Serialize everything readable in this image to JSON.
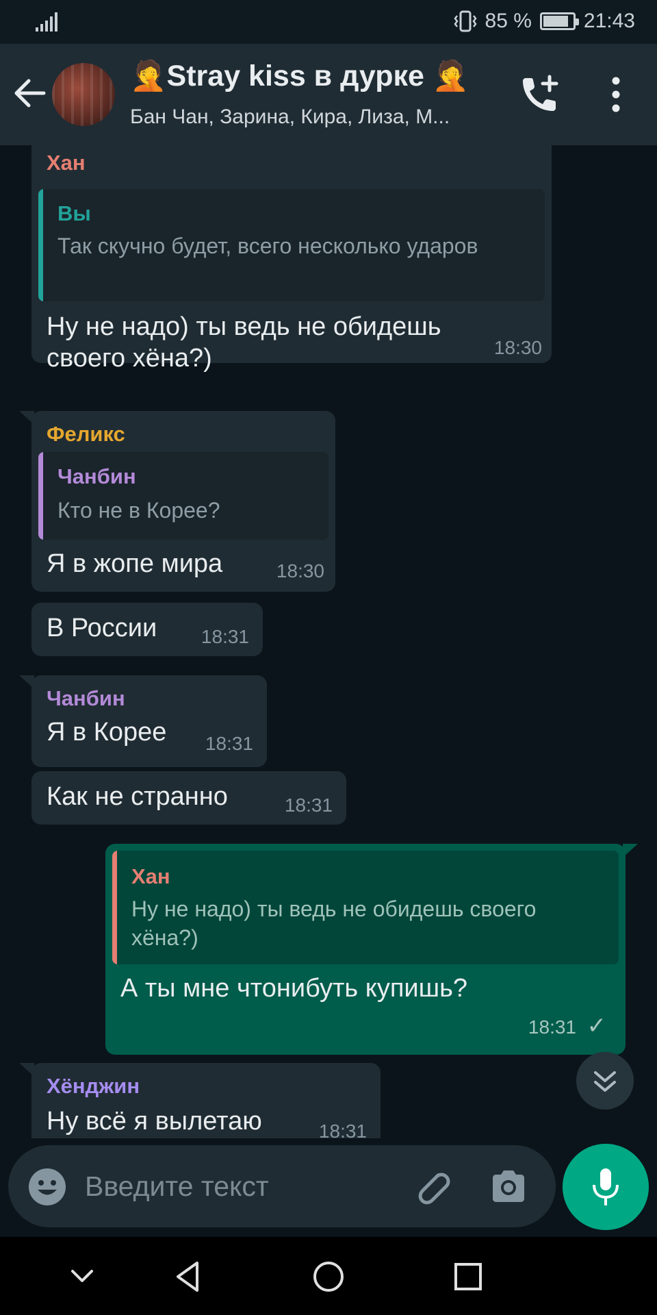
{
  "status_bar": {
    "battery": "85 %",
    "battery_level": 0.85,
    "time": "21:43"
  },
  "header": {
    "title": "🤦Stray kiss в дурке 🤦",
    "subtitle": "Бан Чан, Зарина, Кира, Лиза, М..."
  },
  "colors": {
    "header_bg": "#1f2c34",
    "incoming_bubble": "#202c33",
    "outgoing_bubble": "#005c4b",
    "accent": "#00a884",
    "name_han": "#e57f72",
    "name_felix": "#e5a72f",
    "name_changbin": "#b38ad8",
    "name_you": "#22a39a",
    "name_hyunjin": "#a58df0"
  },
  "messages": [
    {
      "sender": "Хан",
      "quote_name": "Вы",
      "quote_text": "Так скучно будет, всего несколько ударов",
      "text": "Ну не надо) ты ведь не обидешь своего хёна?)",
      "time": "18:30"
    },
    {
      "sender": "Феликс",
      "quote_name": "Чанбин",
      "quote_text": "Кто не в Корее?",
      "text": "Я в жопе мира",
      "time": "18:30"
    },
    {
      "text": "В России",
      "time": "18:31"
    },
    {
      "sender": "Чанбин",
      "text": "Я в Корее",
      "time": "18:31"
    },
    {
      "text": "Как не странно",
      "time": "18:31"
    },
    {
      "quote_name": "Хан",
      "quote_text": "Ну не надо) ты ведь не обидешь своего хёна?)",
      "text": "А ты мне чтонибуть купишь?",
      "time": "18:31",
      "status": "✓"
    },
    {
      "sender": "Хёнджин",
      "text": "Ну всё я вылетаю",
      "time": "18:31"
    }
  ],
  "composer": {
    "placeholder": "Введите текст"
  },
  "icons": {
    "back": "arrow-left-icon",
    "call": "add-call-icon",
    "menu": "more-vertical-icon",
    "emoji": "emoji-icon",
    "attach": "paperclip-icon",
    "camera": "camera-icon",
    "mic": "mic-icon",
    "scroll": "double-chevron-down-icon"
  }
}
